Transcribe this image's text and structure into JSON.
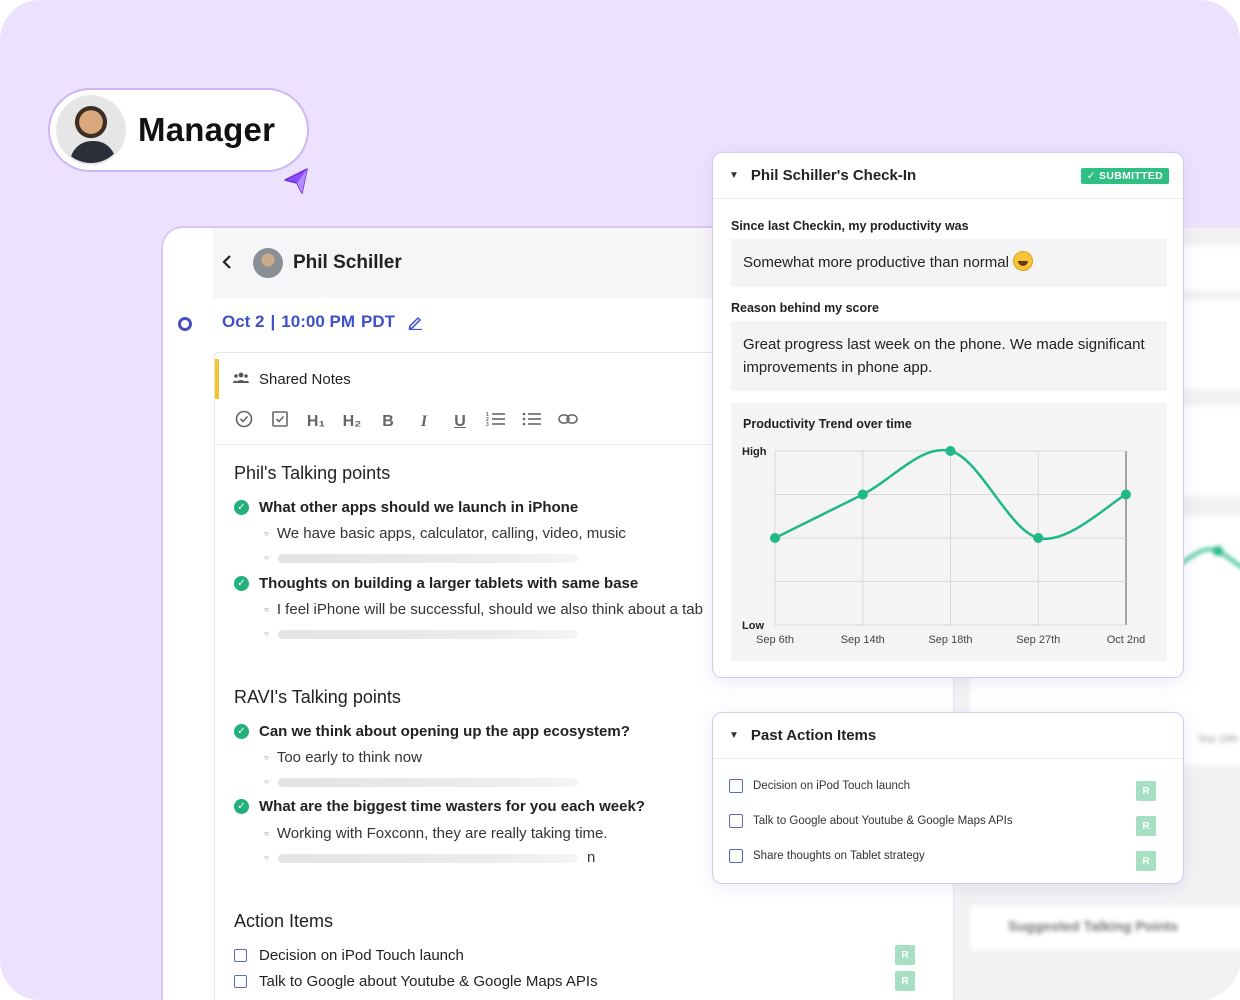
{
  "manager": {
    "label": "Manager"
  },
  "header": {
    "name": "Phil Schiller",
    "date": "Oct 2",
    "separator": "|",
    "time": "10:00 PM",
    "tz": "PDT"
  },
  "notes": {
    "title": "Shared Notes",
    "toolbar": [
      "check-circle",
      "checkbox",
      "H1",
      "H2",
      "B",
      "I",
      "U",
      "ordered-list",
      "bullet-list",
      "link"
    ],
    "toolbar_glyphs": {
      "h1": "H₁",
      "h2": "H₂",
      "bold": "B",
      "italic": "I",
      "underline": "U"
    },
    "phil_section": "Phil's Talking points",
    "phil_points": [
      {
        "text": "What other apps should we launch in iPhone",
        "sub": "We have basic apps, calculator, calling, video, music"
      },
      {
        "text": "Thoughts on building a larger tablets with same base",
        "sub": "I feel iPhone will be successful, should we also think about a tab"
      }
    ],
    "ravi_section": "RAVI's Talking points",
    "ravi_points": [
      {
        "text": "Can we think about opening up the app ecosystem?",
        "sub": "Too early to think now"
      },
      {
        "text": "What are the biggest time wasters for you each week?",
        "sub": "Working with Foxconn, they are really taking time.",
        "trailing": "n"
      }
    ],
    "action_section": "Action Items",
    "action_items": [
      {
        "text": "Decision on iPod Touch launch",
        "badge": "R"
      },
      {
        "text": "Talk to Google about Youtube & Google Maps APIs",
        "badge": "R"
      }
    ]
  },
  "checkin": {
    "title": "Phil Schiller's Check-In",
    "status": "✓ SUBMITTED",
    "q1": "Since last Checkin, my productivity was",
    "a1": "Somewhat more productive than normal",
    "q2": "Reason behind my score",
    "a2": "Great progress last week on the phone. We made significant improvements in phone app.",
    "colors": {
      "accent": "#2fbf83",
      "line": "#1fb887"
    }
  },
  "chart_data": {
    "type": "line",
    "title": "Productivity Trend over time",
    "categories": [
      "Sep 6th",
      "Sep 14th",
      "Sep 18th",
      "Sep 27th",
      "Oct 2nd"
    ],
    "y_tick_labels": [
      "Low",
      "High"
    ],
    "ylim": [
      0,
      4
    ],
    "series": [
      {
        "values": [
          2,
          3,
          4,
          2,
          3
        ]
      }
    ],
    "grid": true,
    "xlabel": "",
    "ylabel": ""
  },
  "past_actions": {
    "title": "Past Action Items",
    "items": [
      {
        "text": "Decision on iPod Touch launch",
        "badge": "R"
      },
      {
        "text": "Talk to Google about Youtube & Google Maps APIs",
        "badge": "R"
      },
      {
        "text": "Share thoughts on Tablet strategy",
        "badge": "R"
      }
    ]
  },
  "background": {
    "suggested": "Suggested Talking Points",
    "tick": "Sep 18th"
  }
}
